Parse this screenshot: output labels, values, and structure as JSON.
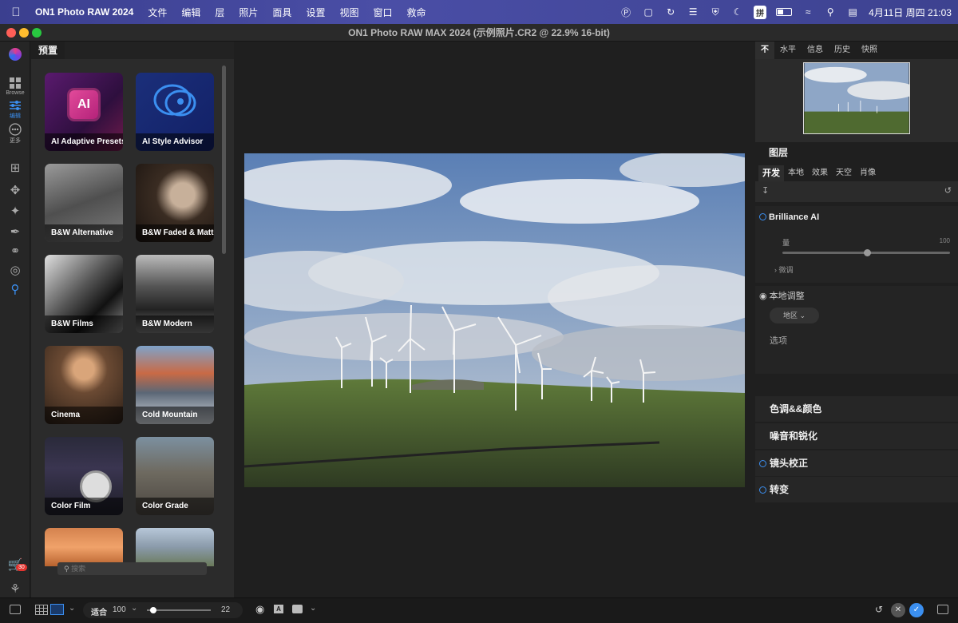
{
  "menubar": {
    "app": "ON1 Photo RAW 2024",
    "items": [
      "文件",
      "编辑",
      "层",
      "照片",
      "面具",
      "设置",
      "视图",
      "窗口",
      "救命"
    ],
    "ime": "拼",
    "clock": "4月11日 周四  21:03"
  },
  "window": {
    "title": "ON1 Photo RAW MAX 2024 (示例照片.CR2 @ 22.9% 16-bit)"
  },
  "toolbar": {
    "browse_label": "Browse",
    "edit_label": "编辑",
    "more_label": "更多",
    "cart_badge": "30"
  },
  "presets": {
    "tab_label": "预置",
    "items": [
      {
        "label": "AI Adaptive Presets",
        "icon": "ai-chip-icon"
      },
      {
        "label": "AI Style Advisor",
        "icon": "chat-bulb-icon"
      },
      {
        "label": "B&W Alternative"
      },
      {
        "label": "B&W Faded & Matte"
      },
      {
        "label": "B&W Films"
      },
      {
        "label": "B&W Modern"
      },
      {
        "label": "Cinema"
      },
      {
        "label": "Cold Mountain"
      },
      {
        "label": "Color Film"
      },
      {
        "label": "Color Grade"
      },
      {
        "label": ""
      },
      {
        "label": ""
      }
    ],
    "search_placeholder": "搜索"
  },
  "right": {
    "top_tabs": [
      "不",
      "水平",
      "信息",
      "历史",
      "快照"
    ],
    "layers_label": "图层",
    "sub_tabs": [
      "开发",
      "本地",
      "效果",
      "天空",
      "肖像"
    ],
    "brilliance": {
      "title": "Brilliance AI",
      "amount_label": "量",
      "amount_value": "100",
      "fine_tune": "微调",
      "local_adjust": "本地调整",
      "region": "地区"
    },
    "options_label": "选项",
    "sections": [
      {
        "label": "色调&&颜色",
        "circle": false
      },
      {
        "label": "噪音和锐化",
        "circle": false
      },
      {
        "label": "镜头校正",
        "circle": true
      },
      {
        "label": "转变",
        "circle": true
      }
    ]
  },
  "bottom": {
    "fit_label": "适合",
    "zoom_value": "100",
    "slider_value": "22",
    "slider_fraction": 0.05
  },
  "colors": {
    "accent": "#3b8ff0",
    "badge": "#e2342f"
  }
}
